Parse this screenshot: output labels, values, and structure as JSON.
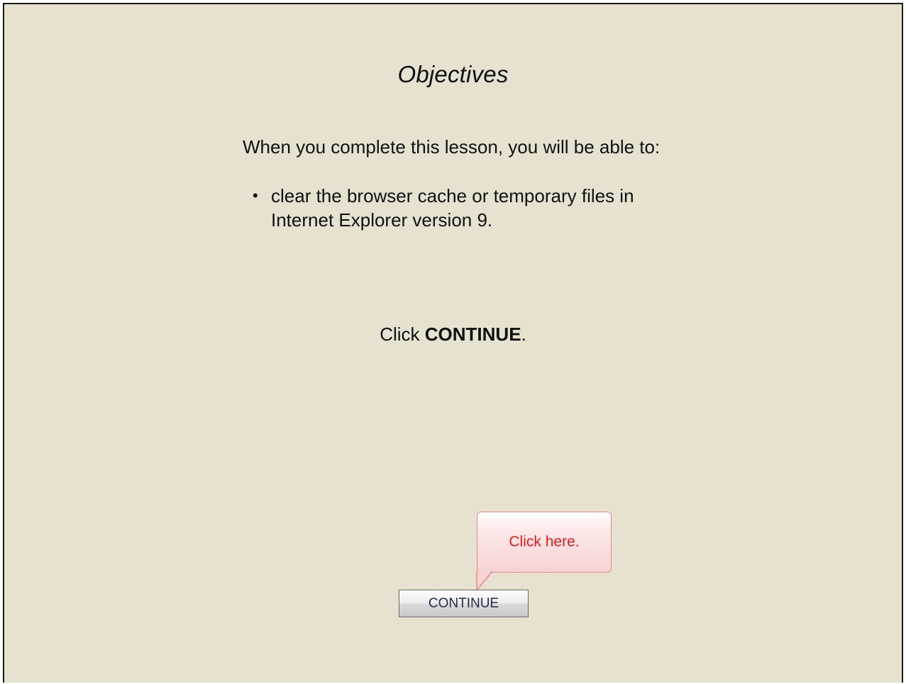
{
  "slide": {
    "title": "Objectives",
    "intro": "When you complete this lesson, you will be able to:",
    "objectives": [
      "clear the browser cache or temporary files in Internet Explorer version 9."
    ],
    "bullet_glyph": "•",
    "instruction_prefix": "Click ",
    "instruction_emphasis": "CONTINUE",
    "instruction_suffix": "."
  },
  "callout": {
    "text": "Click here.",
    "text_color": "#e0191b",
    "border_color": "#e58a8a"
  },
  "continue_button": {
    "label": "CONTINUE"
  },
  "colors": {
    "background": "#e6e2cf",
    "border": "#1a1a1a",
    "button_text": "#1f2d4d"
  }
}
